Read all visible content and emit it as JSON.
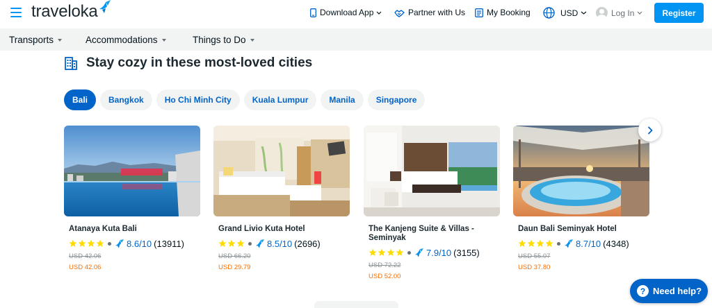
{
  "header": {
    "logo_text": "traveloka",
    "download_app": "Download App",
    "partner": "Partner with Us",
    "my_booking": "My Booking",
    "currency": "USD",
    "login": "Log In",
    "register": "Register",
    "icons": [
      "hamburger-icon",
      "traveloka-bird-icon",
      "phone-icon",
      "partner-icon",
      "booking-icon",
      "globe-icon",
      "chevron-down-icon",
      "avatar-icon"
    ]
  },
  "subnav": {
    "items": [
      {
        "label": "Transports"
      },
      {
        "label": "Accommodations"
      },
      {
        "label": "Things to Do"
      }
    ]
  },
  "section": {
    "title": "Stay cozy in these most-loved cities",
    "icon": "building-icon"
  },
  "cities": [
    {
      "label": "Bali",
      "active": true
    },
    {
      "label": "Bangkok",
      "active": false
    },
    {
      "label": "Ho Chi Minh City",
      "active": false
    },
    {
      "label": "Kuala Lumpur",
      "active": false
    },
    {
      "label": "Manila",
      "active": false
    },
    {
      "label": "Singapore",
      "active": false
    }
  ],
  "hotels": [
    {
      "name": "Atanaya Kuta Bali",
      "stars": 4,
      "score": "8.6/10",
      "reviews": "(13911)",
      "old_price": "USD 42.06",
      "new_price": "USD 42.06"
    },
    {
      "name": "Grand Livio Kuta Hotel",
      "stars": 3,
      "score": "8.5/10",
      "reviews": "(2696)",
      "old_price": "USD 66.20",
      "new_price": "USD 29.79"
    },
    {
      "name": "The Kanjeng Suite & Villas - Seminyak",
      "stars": 4,
      "score": "7.9/10",
      "reviews": "(3155)",
      "old_price": "USD 72.22",
      "new_price": "USD 52.00"
    },
    {
      "name": "Daun Bali Seminyak Hotel",
      "stars": 4,
      "score": "8.7/10",
      "reviews": "(4348)",
      "old_price": "USD 55.07",
      "new_price": "USD 37.80"
    }
  ],
  "help": {
    "label": "Need help?",
    "icon_text": "?"
  },
  "colors": {
    "brand": "#0194f3",
    "link": "#0264c8",
    "price": "#f96d01",
    "star": "#ffdc00"
  }
}
